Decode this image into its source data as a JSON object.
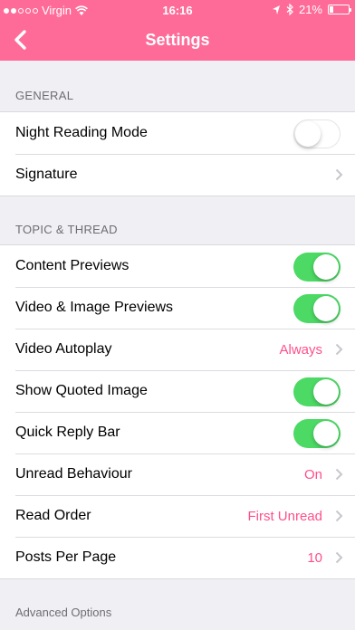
{
  "status_bar": {
    "carrier": "Virgin",
    "time": "16:16",
    "battery": "21%",
    "battery_level": 0.21,
    "signal_bars_filled": 2,
    "signal_bars_total": 5
  },
  "nav": {
    "title": "Settings"
  },
  "sections": {
    "general": {
      "header": "GENERAL",
      "rows": [
        {
          "label": "Night Reading Mode",
          "type": "toggle",
          "state": false
        },
        {
          "label": "Signature",
          "type": "disclosure"
        }
      ]
    },
    "topic": {
      "header": "TOPIC & THREAD",
      "rows": [
        {
          "label": "Content Previews",
          "type": "toggle",
          "state": true
        },
        {
          "label": "Video & Image Previews",
          "type": "toggle",
          "state": true
        },
        {
          "label": "Video Autoplay",
          "type": "disclosure",
          "value": "Always"
        },
        {
          "label": "Show Quoted Image",
          "type": "toggle",
          "state": true
        },
        {
          "label": "Quick Reply Bar",
          "type": "toggle",
          "state": true
        },
        {
          "label": "Unread Behaviour",
          "type": "disclosure",
          "value": "On"
        },
        {
          "label": "Read Order",
          "type": "disclosure",
          "value": "First Unread"
        },
        {
          "label": "Posts Per Page",
          "type": "disclosure",
          "value": "10"
        }
      ]
    },
    "advanced": {
      "header": "Advanced Options"
    }
  },
  "colors": {
    "accent": "#ff6b98",
    "value_text": "#ff4f8b",
    "toggle_on": "#4cd964"
  }
}
